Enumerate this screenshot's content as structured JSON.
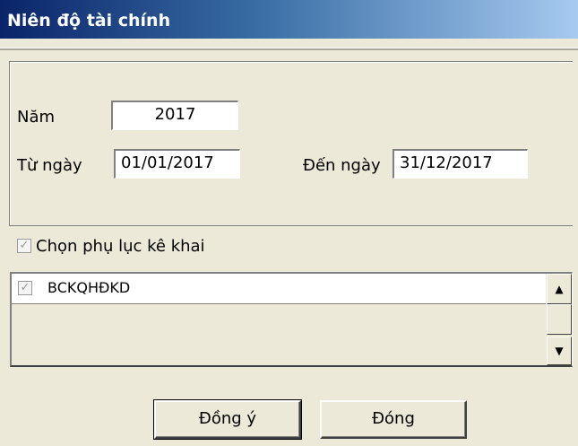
{
  "window": {
    "title": "Niên độ tài chính"
  },
  "fiscal": {
    "year_label": "Năm",
    "year_value": "2017",
    "from_label": "Từ ngày",
    "from_value": "01/01/2017",
    "to_label": "Đến ngày",
    "to_value": "31/12/2017"
  },
  "appendix": {
    "checkbox_label": "Chọn phụ lục kê khai",
    "checked": true,
    "items": [
      {
        "label": "BCKQHĐKD",
        "checked": true
      }
    ]
  },
  "scrollbar": {
    "up_icon": "▲",
    "down_icon": "▼"
  },
  "buttons": {
    "ok_label": "Đồng ý",
    "close_label": "Đóng"
  },
  "icons": {
    "check": "✓"
  }
}
